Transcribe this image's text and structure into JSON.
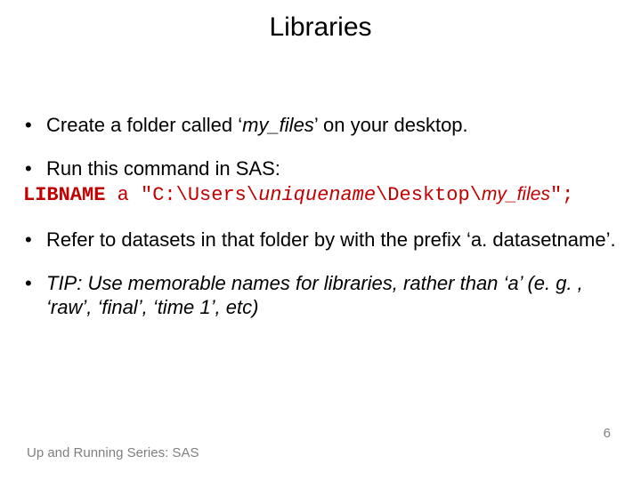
{
  "title": "Libraries",
  "bullets": {
    "b1_pre": "Create a folder called ‘",
    "b1_em": "my_files",
    "b1_post": "’ on your desktop.",
    "b2": "Run this command in SAS:",
    "code_kw": "LIBNAME",
    "code_a": " a ",
    "code_q1": "\"C:\\Users\\",
    "code_unique": "uniquename",
    "code_q2": "\\Desktop\\",
    "code_myfiles": "my_files",
    "code_end": "\";",
    "b3": "Refer to datasets in that folder by with the prefix ‘a. datasetname’.",
    "b4": "TIP: Use memorable names for libraries, rather than ‘a’ (e. g. , ‘raw’, ‘final’, ‘time 1’, etc)"
  },
  "footer": "Up and Running Series: SAS",
  "page": "6",
  "dot": "•"
}
